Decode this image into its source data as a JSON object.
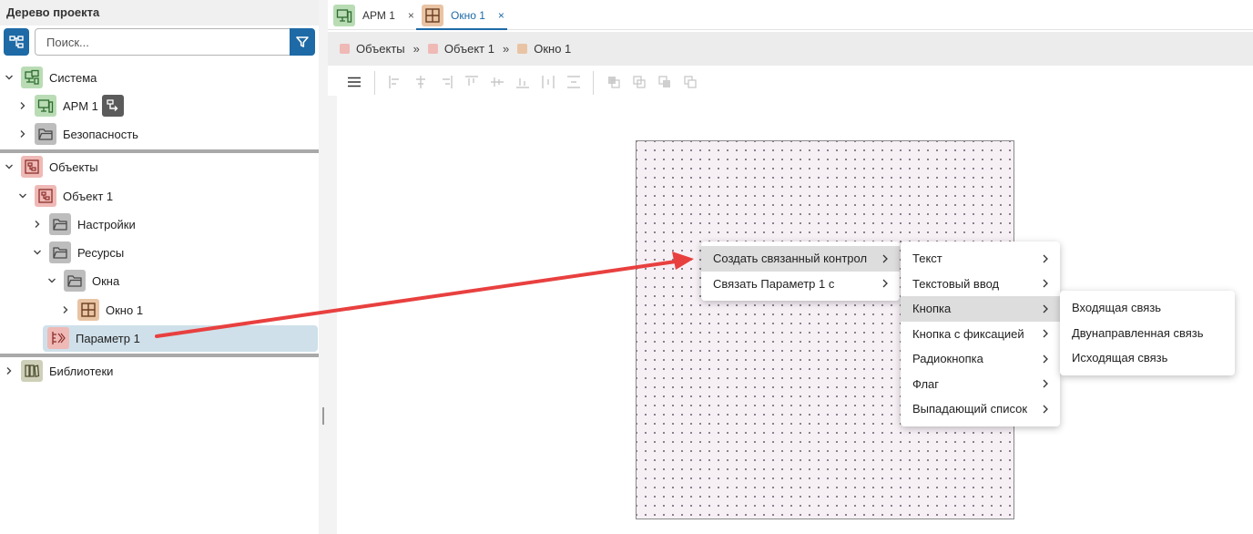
{
  "project_tree": {
    "title": "Дерево проекта",
    "search_placeholder": "Поиск...",
    "items": [
      {
        "label": "Система",
        "icon": "system-icon",
        "expanded": true
      },
      {
        "label": "АРМ 1",
        "icon": "workstation-icon",
        "expanded": false
      },
      {
        "label": "Безопасность",
        "icon": "folder-icon",
        "expanded": false
      },
      {
        "label": "Объекты",
        "icon": "objects-icon",
        "expanded": true
      },
      {
        "label": "Объект 1",
        "icon": "object-icon",
        "expanded": true
      },
      {
        "label": "Настройки",
        "icon": "folder-icon",
        "expanded": false
      },
      {
        "label": "Ресурсы",
        "icon": "folder-icon",
        "expanded": true
      },
      {
        "label": "Окна",
        "icon": "folder-icon",
        "expanded": true
      },
      {
        "label": "Окно 1",
        "icon": "window-icon",
        "expanded": false
      },
      {
        "label": "Параметр 1",
        "icon": "parameter-icon",
        "selected": true
      },
      {
        "label": "Библиотеки",
        "icon": "library-icon",
        "expanded": false
      }
    ]
  },
  "tabs": [
    {
      "label": "АРМ 1",
      "close": "×",
      "icon": "workstation-icon"
    },
    {
      "label": "Окно 1",
      "close": "×",
      "icon": "window-icon",
      "active": true
    }
  ],
  "breadcrumb": [
    {
      "label": "Объекты",
      "color": "#efb9b6"
    },
    {
      "label": "Объект 1",
      "color": "#efb9b6"
    },
    {
      "label": "Окно 1",
      "color": "#e8c4a4"
    }
  ],
  "breadcrumb_separator": "»",
  "context_menu": {
    "items": [
      {
        "label": "Создать связанный контрол",
        "highlighted": true
      },
      {
        "label": "Связать Параметр 1 с"
      }
    ]
  },
  "control_submenu": {
    "items": [
      {
        "label": "Текст"
      },
      {
        "label": "Текстовый ввод"
      },
      {
        "label": "Кнопка",
        "highlighted": true
      },
      {
        "label": "Кнопка с фиксацией"
      },
      {
        "label": "Радиокнопка"
      },
      {
        "label": "Флаг"
      },
      {
        "label": "Выпадающий список"
      }
    ]
  },
  "link_submenu": {
    "items": [
      {
        "label": "Входящая связь"
      },
      {
        "label": "Двунаправленная связь"
      },
      {
        "label": "Исходящая связь"
      }
    ]
  },
  "colors": {
    "accent": "#1e6aa6",
    "annotation_arrow": "#e8403f",
    "selection": "#cfe0ea"
  }
}
